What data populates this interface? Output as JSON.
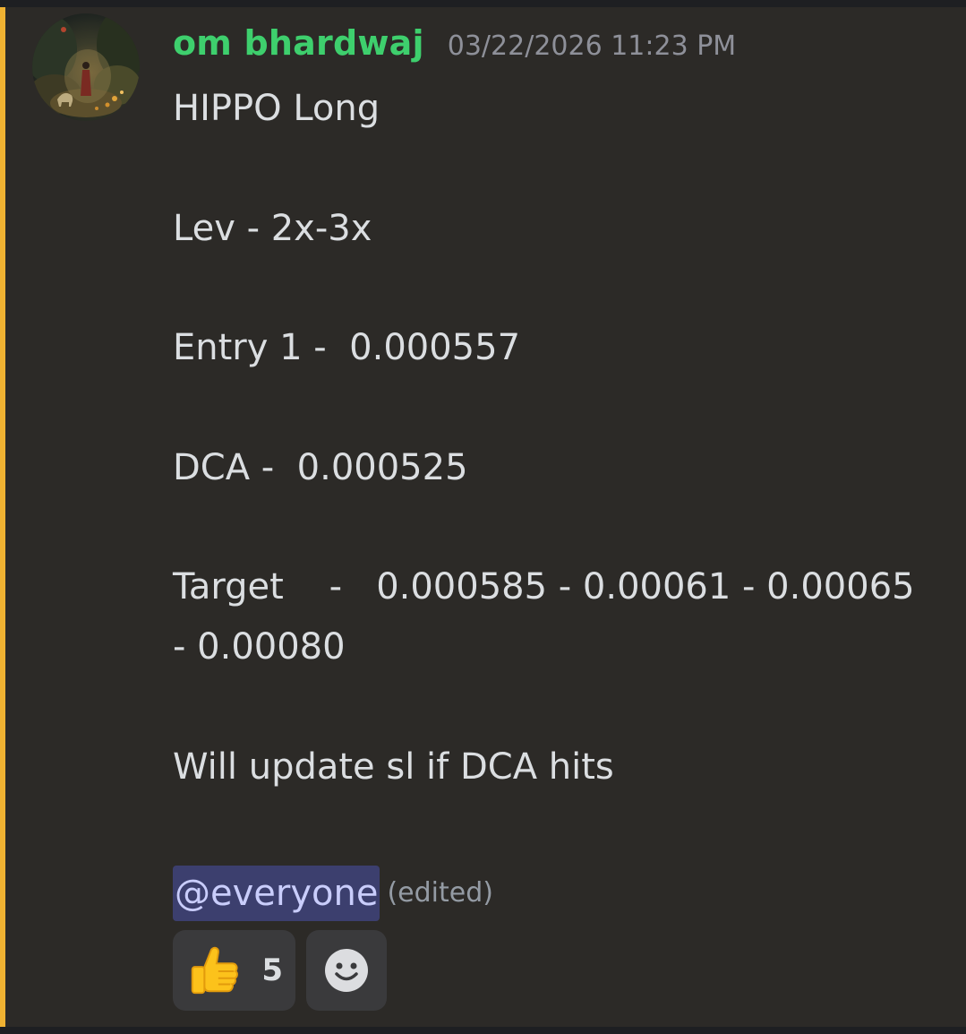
{
  "message": {
    "username": "om bhardwaj",
    "timestamp": "03/22/2026 11:23 PM",
    "lines": {
      "l1": "HIPPO Long",
      "l2": "Lev - 2x-3x",
      "l3": "Entry 1 -  0.000557",
      "l4": "DCA -  0.000525",
      "l5": "Target    -   0.000585 - 0.00061 - 0.00065",
      "l6": "- 0.00080",
      "l7": "Will update sl if DCA hits"
    },
    "mention": "@everyone",
    "edited": "(edited)",
    "accent_color": "#f0b232",
    "username_color": "#3ecf6d"
  },
  "reactions": {
    "thumbs_up": {
      "icon": "thumbs-up-emoji",
      "count": "5"
    },
    "add_reaction": {
      "icon": "smiley-face-icon"
    }
  }
}
